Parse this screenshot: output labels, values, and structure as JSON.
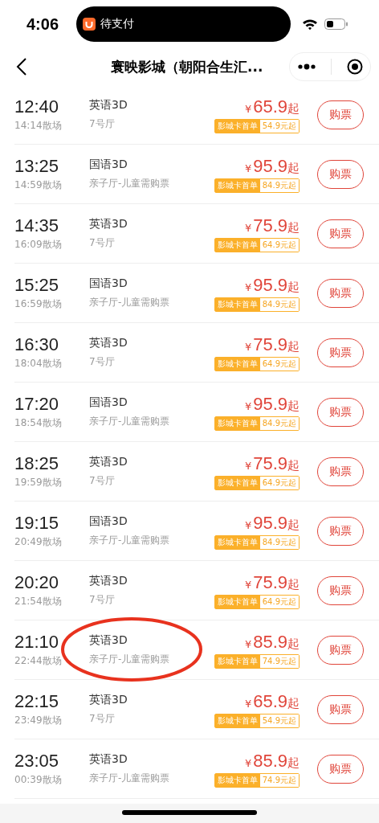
{
  "status_bar": {
    "time": "4:06",
    "activity": "待支付"
  },
  "nav": {
    "title": "寰映影城（朝阳合生汇..."
  },
  "showtimes": [
    {
      "start": "12:40",
      "end": "14:14散场",
      "format": "英语3D",
      "hall": "7号厅",
      "price_symbol": "¥",
      "price": "65.9",
      "price_suffix": "起",
      "card_label": "影城卡首单",
      "card_price": "54.9元起",
      "button": "购票",
      "circled": false
    },
    {
      "start": "13:25",
      "end": "14:59散场",
      "format": "国语3D",
      "hall": "亲子厅-儿童需购票",
      "price_symbol": "¥",
      "price": "95.9",
      "price_suffix": "起",
      "card_label": "影城卡首单",
      "card_price": "84.9元起",
      "button": "购票",
      "circled": false
    },
    {
      "start": "14:35",
      "end": "16:09散场",
      "format": "英语3D",
      "hall": "7号厅",
      "price_symbol": "¥",
      "price": "75.9",
      "price_suffix": "起",
      "card_label": "影城卡首单",
      "card_price": "64.9元起",
      "button": "购票",
      "circled": false
    },
    {
      "start": "15:25",
      "end": "16:59散场",
      "format": "国语3D",
      "hall": "亲子厅-儿童需购票",
      "price_symbol": "¥",
      "price": "95.9",
      "price_suffix": "起",
      "card_label": "影城卡首单",
      "card_price": "84.9元起",
      "button": "购票",
      "circled": false
    },
    {
      "start": "16:30",
      "end": "18:04散场",
      "format": "英语3D",
      "hall": "7号厅",
      "price_symbol": "¥",
      "price": "75.9",
      "price_suffix": "起",
      "card_label": "影城卡首单",
      "card_price": "64.9元起",
      "button": "购票",
      "circled": false
    },
    {
      "start": "17:20",
      "end": "18:54散场",
      "format": "国语3D",
      "hall": "亲子厅-儿童需购票",
      "price_symbol": "¥",
      "price": "95.9",
      "price_suffix": "起",
      "card_label": "影城卡首单",
      "card_price": "84.9元起",
      "button": "购票",
      "circled": false
    },
    {
      "start": "18:25",
      "end": "19:59散场",
      "format": "英语3D",
      "hall": "7号厅",
      "price_symbol": "¥",
      "price": "75.9",
      "price_suffix": "起",
      "card_label": "影城卡首单",
      "card_price": "64.9元起",
      "button": "购票",
      "circled": false
    },
    {
      "start": "19:15",
      "end": "20:49散场",
      "format": "国语3D",
      "hall": "亲子厅-儿童需购票",
      "price_symbol": "¥",
      "price": "95.9",
      "price_suffix": "起",
      "card_label": "影城卡首单",
      "card_price": "84.9元起",
      "button": "购票",
      "circled": false
    },
    {
      "start": "20:20",
      "end": "21:54散场",
      "format": "英语3D",
      "hall": "7号厅",
      "price_symbol": "¥",
      "price": "75.9",
      "price_suffix": "起",
      "card_label": "影城卡首单",
      "card_price": "64.9元起",
      "button": "购票",
      "circled": false
    },
    {
      "start": "21:10",
      "end": "22:44散场",
      "format": "英语3D",
      "hall": "亲子厅-儿童需购票",
      "price_symbol": "¥",
      "price": "85.9",
      "price_suffix": "起",
      "card_label": "影城卡首单",
      "card_price": "74.9元起",
      "button": "购票",
      "circled": true
    },
    {
      "start": "22:15",
      "end": "23:49散场",
      "format": "英语3D",
      "hall": "7号厅",
      "price_symbol": "¥",
      "price": "65.9",
      "price_suffix": "起",
      "card_label": "影城卡首单",
      "card_price": "54.9元起",
      "button": "购票",
      "circled": false
    },
    {
      "start": "23:05",
      "end": "00:39散场",
      "format": "英语3D",
      "hall": "亲子厅-儿童需购票",
      "price_symbol": "¥",
      "price": "85.9",
      "price_suffix": "起",
      "card_label": "影城卡首单",
      "card_price": "74.9元起",
      "button": "购票",
      "circled": false
    }
  ]
}
